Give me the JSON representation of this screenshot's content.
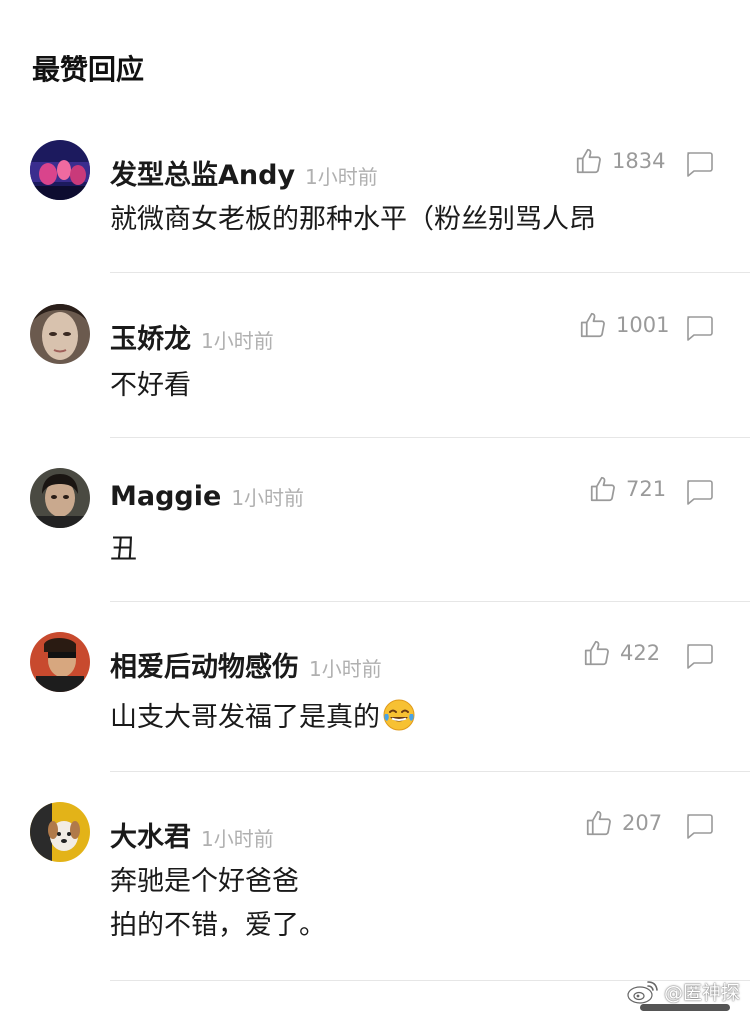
{
  "section_title": "最赞回应",
  "comments": [
    {
      "username": "发型总监Andy",
      "time": "1小时前",
      "likes": "1834",
      "lines": [
        "就微商女老板的那种水平（粉丝别骂人昂"
      ]
    },
    {
      "username": "玉娇龙",
      "time": "1小时前",
      "likes": "1001",
      "lines": [
        "不好看"
      ]
    },
    {
      "username": "Maggie",
      "time": "1小时前",
      "likes": "721",
      "lines": [
        "丑"
      ]
    },
    {
      "username": "相爱后动物感伤",
      "time": "1小时前",
      "likes": "422",
      "lines": [
        "山支大哥发福了是真的"
      ]
    },
    {
      "username": "大水君",
      "time": "1小时前",
      "likes": "207",
      "lines": [
        "奔驰是个好爸爸",
        "拍的不错，爱了。"
      ]
    }
  ],
  "watermark": "@匿神探",
  "icons": {
    "like": "thumbs-up-icon",
    "reply": "speech-bubble-icon",
    "emoji": "tears-of-joy-emoji-icon",
    "watermark_logo": "weibo-logo-icon"
  },
  "colors": {
    "text": "#1a1a1a",
    "meta": "#b0b0b0",
    "icon": "#9a9a9a",
    "divider": "#e6e6e6"
  }
}
